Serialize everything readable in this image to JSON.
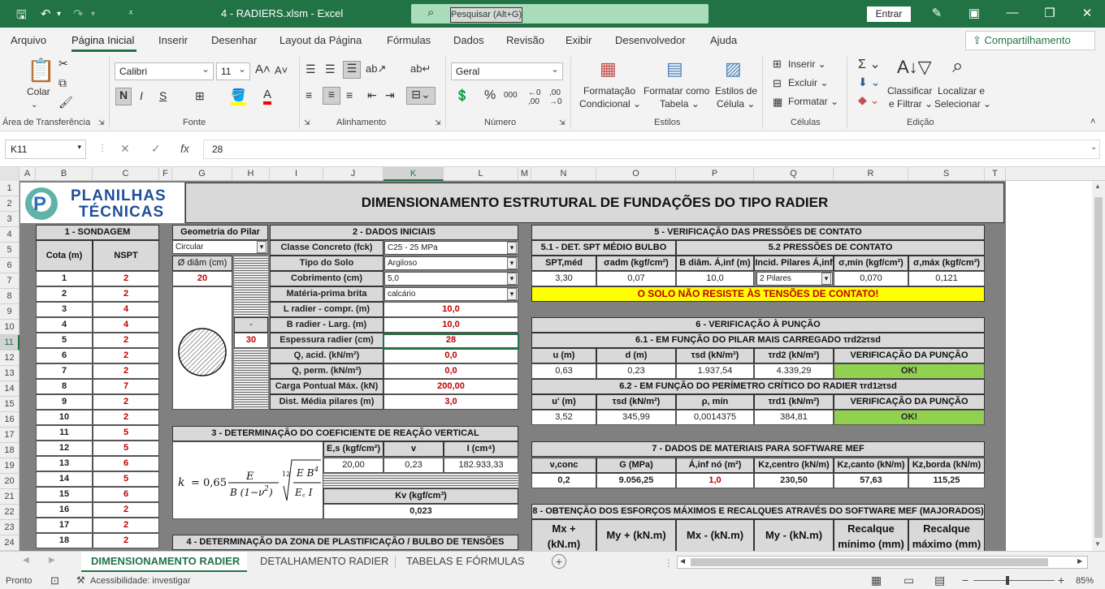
{
  "titlebar": {
    "doc_title": "4 - RADIERS.xlsm  -  Excel",
    "search_placeholder": "Pesquisar (Alt+G)",
    "signin": "Entrar"
  },
  "ribbon_tabs": [
    "Arquivo",
    "Página Inicial",
    "Inserir",
    "Desenhar",
    "Layout da Página",
    "Fórmulas",
    "Dados",
    "Revisão",
    "Exibir",
    "Desenvolvedor",
    "Ajuda"
  ],
  "share": "Compartilhamento",
  "ribbon": {
    "clipboard": {
      "paste": "Colar",
      "label": "Área de Transferência"
    },
    "font": {
      "name": "Calibri",
      "size": "11",
      "bold": "N",
      "italic": "I",
      "underline": "S",
      "label": "Fonte"
    },
    "alignment": {
      "label": "Alinhamento"
    },
    "number": {
      "format": "Geral",
      "label": "Número"
    },
    "styles": {
      "cond": "Formatação",
      "cond2": "Condicional",
      "table": "Formatar como",
      "table2": "Tabela",
      "cell": "Estilos de",
      "cell2": "Célula",
      "label": "Estilos"
    },
    "cells": {
      "insert": "Inserir",
      "delete": "Excluir",
      "format": "Formatar",
      "label": "Células"
    },
    "editing": {
      "sort": "Classificar",
      "sort2": "e Filtrar",
      "find": "Localizar e",
      "find2": "Selecionar",
      "label": "Edição"
    }
  },
  "formula_bar": {
    "namebox": "K11",
    "value": "28"
  },
  "columns": [
    "A",
    "B",
    "C",
    "F",
    "G",
    "H",
    "I",
    "J",
    "K",
    "L",
    "M",
    "N",
    "O",
    "P",
    "Q",
    "R",
    "S",
    "T"
  ],
  "rows": [
    "1",
    "2",
    "3",
    "4",
    "5",
    "6",
    "7",
    "8",
    "9",
    "10",
    "11",
    "12",
    "13",
    "14",
    "15",
    "16",
    "17",
    "18",
    "19",
    "20",
    "21",
    "22",
    "23",
    "24"
  ],
  "logo": {
    "line1": "PLANILHAS",
    "line2": "TÉCNICAS"
  },
  "main_title": "DIMENSIONAMENTO ESTRUTURAL DE FUNDAÇÕES DO TIPO RADIER",
  "sondagem": {
    "title": "1 - SONDAGEM",
    "h_cota": "Cota (m)",
    "h_nspt": "NSPT",
    "rows": [
      [
        "1",
        "2"
      ],
      [
        "2",
        "2"
      ],
      [
        "3",
        "4"
      ],
      [
        "4",
        "4"
      ],
      [
        "5",
        "2"
      ],
      [
        "6",
        "2"
      ],
      [
        "7",
        "2"
      ],
      [
        "8",
        "7"
      ],
      [
        "9",
        "2"
      ],
      [
        "10",
        "2"
      ],
      [
        "11",
        "5"
      ],
      [
        "12",
        "5"
      ],
      [
        "13",
        "6"
      ],
      [
        "14",
        "5"
      ],
      [
        "15",
        "6"
      ],
      [
        "16",
        "2"
      ],
      [
        "17",
        "2"
      ],
      [
        "18",
        "2"
      ]
    ]
  },
  "pilar": {
    "title": "Geometria do Pilar",
    "shape": "Circular",
    "diam_label": "Ø diâm (cm)",
    "diam": "20",
    "dash": "-",
    "val30": "30"
  },
  "dados": {
    "title": "2 - DADOS INICIAIS",
    "rows": [
      {
        "label": "Classe Concreto (fck)",
        "value": "C25 - 25 MPa",
        "dd": true
      },
      {
        "label": "Tipo do Solo",
        "value": "Argiloso",
        "dd": true
      },
      {
        "label": "Cobrimento (cm)",
        "value": "5,0",
        "dd": true
      },
      {
        "label": "Matéria-prima brita",
        "value": "calcário",
        "dd": true
      },
      {
        "label": "L radier - compr. (m)",
        "value": "10,0"
      },
      {
        "label": "B radier - Larg. (m)",
        "value": "10,0"
      },
      {
        "label": "Espessura radier (cm)",
        "value": "28"
      },
      {
        "label": "Q, acid. (kN/m²)",
        "value": "0,0"
      },
      {
        "label": "Q, perm. (kN/m²)",
        "value": "0,0"
      },
      {
        "label": "Carga Pontual Máx. (kN)",
        "value": "200,00"
      },
      {
        "label": "Dist. Média pilares (m)",
        "value": "3,0"
      }
    ]
  },
  "coef": {
    "title": "3 - DETERMINAÇÃO DO COEFICIENTE DE REAÇÃO VERTICAL",
    "formula": "k = 0,65 · E / B(1−ν²) · ¹²√(E B⁴ / E꜀ I)",
    "h_es": "E,s (kgf/cm²)",
    "h_v": "v",
    "h_i": "I (cm⁴)",
    "es": "20,00",
    "v": "0,23",
    "i": "182.933,33",
    "h_kv": "Kv (kgf/cm³)",
    "kv": "0,023"
  },
  "plast": {
    "title": "4 - DETERMINAÇÃO DA ZONA DE PLASTIFICAÇÃO / BULBO DE TENSÕES"
  },
  "pressoes": {
    "title": "5 - VERIFICAÇÃO DAS PRESSÕES DE CONTATO",
    "t51": "5.1 - DET. SPT MÉDIO BULBO",
    "t52": "5.2  PRESSÕES DE CONTATO",
    "headers": [
      "SPT,méd",
      "σadm (kgf/cm²)",
      "B diâm. Á,inf (m)",
      "Incid. Pilares Á,inf",
      "σ,mín (kgf/cm²)",
      "σ,máx (kgf/cm²)"
    ],
    "values": [
      "3,30",
      "0,07",
      "10,0",
      "2 Pilares",
      "0,070",
      "0,121"
    ],
    "warning": "O SOLO NÃO RESISTE ÀS TENSÕES DE CONTATO!"
  },
  "puncao": {
    "title": "6 - VERIFICAÇÃO À PUNÇÃO",
    "t61": "6.1 - EM FUNÇÃO DO PILAR MAIS CARREGADO τrd2≥τsd",
    "h1": [
      "u (m)",
      "d (m)",
      "τsd (kN/m²)",
      "τrd2 (kN/m²)",
      "VERIFICAÇÃO DA PUNÇÃO"
    ],
    "v1": [
      "0,63",
      "0,23",
      "1.937,54",
      "4.339,29",
      "OK!"
    ],
    "t62": "6.2 - EM FUNÇÃO DO PERÍMETRO CRÍTICO DO RADIER τrd1≥τsd",
    "h2": [
      "u' (m)",
      "τsd (kN/m²)",
      "ρ, mín",
      "τrd1 (kN/m²)",
      "VERIFICAÇÃO DA PUNÇÃO"
    ],
    "v2": [
      "3,52",
      "345,99",
      "0,0014375",
      "384,81",
      "OK!"
    ]
  },
  "mef": {
    "title": "7 - DADOS DE MATERIAIS PARA SOFTWARE MEF",
    "headers": [
      "ν,conc",
      "G (MPa)",
      "Á,inf nó (m²)",
      "Kz,centro (kN/m)",
      "Kz,canto (kN/m)",
      "Kz,borda (kN/m)"
    ],
    "values": [
      "0,2",
      "9.056,25",
      "1,0",
      "230,50",
      "57,63",
      "115,25"
    ]
  },
  "esforcos": {
    "title": "8 - OBTENÇÃO DOS ESFORÇOS MÁXIMOS E RECALQUES ATRAVÉS DO SOFTWARE MEF (MAJORADOS)",
    "headers": [
      "Mx +\n(kN.m)",
      "My + (kN.m)",
      "Mx - (kN.m)",
      "My - (kN.m)",
      "Recalque\nmínimo (mm)",
      "Recalque\nmáximo (mm)"
    ]
  },
  "sheet_tabs": [
    "DIMENSIONAMENTO RADIER",
    "DETALHAMENTO RADIER",
    "TABELAS E FÓRMULAS"
  ],
  "status": {
    "ready": "Pronto",
    "access": "Acessibilidade: investigar",
    "zoom": "85%"
  }
}
